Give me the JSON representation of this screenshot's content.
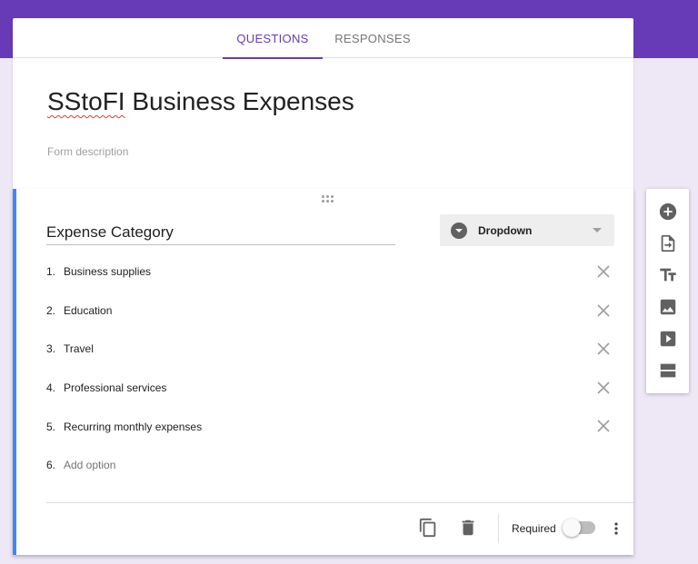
{
  "tabs": [
    {
      "label": "QUESTIONS",
      "active": true
    },
    {
      "label": "RESPONSES",
      "active": false
    }
  ],
  "form": {
    "title_marked": "SStoFI",
    "title_rest": " Business Expenses",
    "description_placeholder": "Form description"
  },
  "question": {
    "title": "Expense Category",
    "type": "Dropdown",
    "options": [
      {
        "num": "1.",
        "label": "Business supplies"
      },
      {
        "num": "2.",
        "label": "Education"
      },
      {
        "num": "3.",
        "label": "Travel"
      },
      {
        "num": "4.",
        "label": "Professional services"
      },
      {
        "num": "5.",
        "label": "Recurring monthly expenses"
      }
    ],
    "add_option": {
      "num": "6.",
      "label": "Add option"
    },
    "required_label": "Required",
    "required": false
  },
  "side_toolbar": {
    "icons": [
      "add-question-icon",
      "import-questions-icon",
      "add-title-icon",
      "add-image-icon",
      "add-video-icon",
      "add-section-icon"
    ]
  },
  "colors": {
    "brand": "#673ab7",
    "background": "#ede7f6",
    "active_card_border": "#4285f4"
  }
}
